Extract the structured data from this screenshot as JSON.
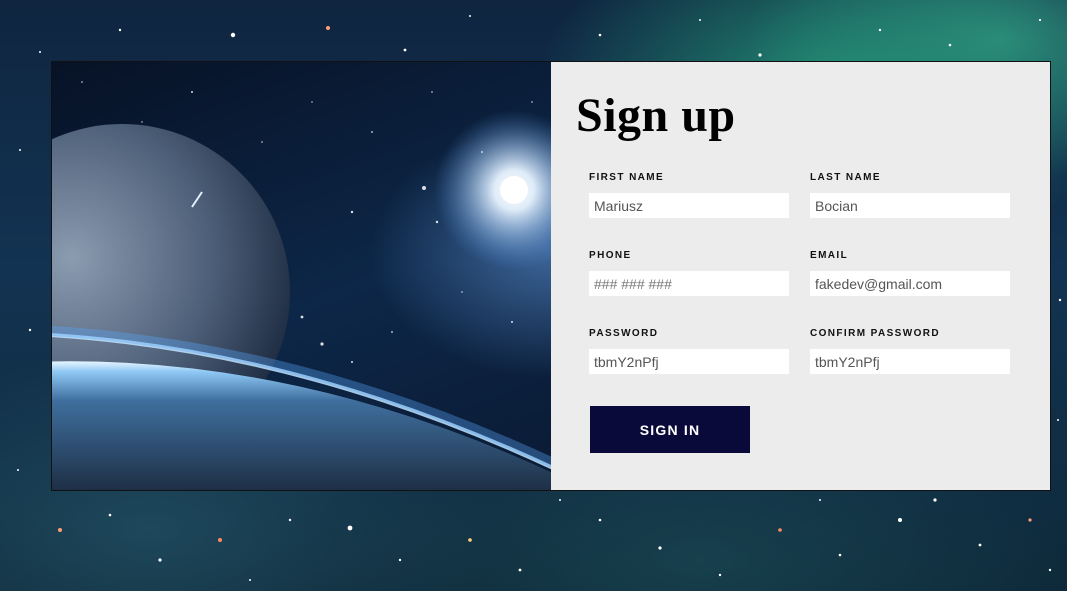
{
  "form": {
    "title": "Sign up",
    "fields": [
      {
        "label": "FIRST NAME",
        "value": "Mariusz"
      },
      {
        "label": "LAST NAME",
        "value": "Bocian"
      },
      {
        "label": "PHONE",
        "value": "",
        "placeholder": "### ### ###"
      },
      {
        "label": "EMAIL",
        "value": "fakedev@gmail.com"
      },
      {
        "label": "PASSWORD",
        "value": "tbmY2nPfj"
      },
      {
        "label": "CONFIRM PASSWORD",
        "value": "tbmY2nPfj"
      }
    ],
    "submit_label": "SIGN IN"
  },
  "colors": {
    "button_bg": "#0a0a3a",
    "panel_bg": "#ececec"
  },
  "icons": {
    "hero_image": "space-planet-image",
    "background": "starfield-background"
  }
}
